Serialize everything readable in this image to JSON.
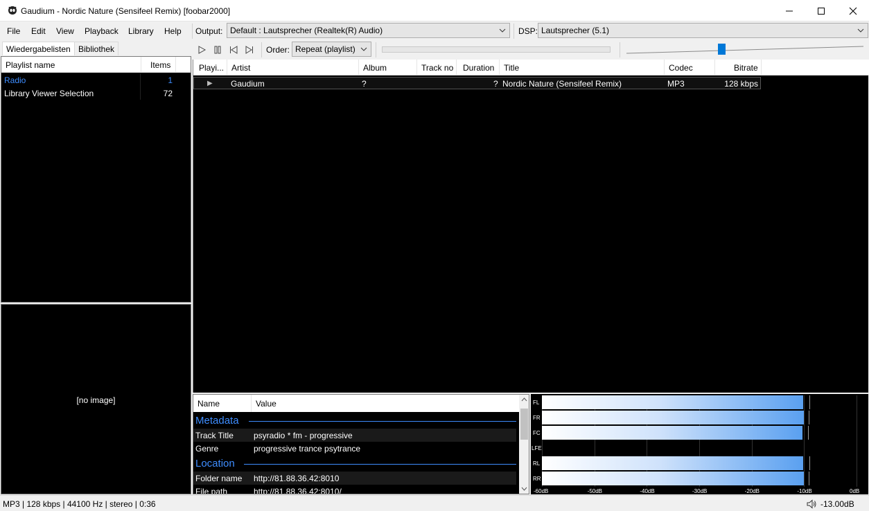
{
  "window": {
    "title": "Gaudium - Nordic Nature (Sensifeel Remix)  [foobar2000]"
  },
  "menu": [
    "File",
    "Edit",
    "View",
    "Playback",
    "Library",
    "Help"
  ],
  "toolbar": {
    "output_label": "Output:",
    "output_value": "Default : Lautsprecher (Realtek(R) Audio)",
    "dsp_label": "DSP:",
    "dsp_value": "Lautsprecher (5.1)",
    "order_label": "Order:",
    "order_value": "Repeat (playlist)",
    "volume_level": 0.4
  },
  "left_panel": {
    "tabs": [
      "Wiedergabelisten",
      "Bibliothek"
    ],
    "columns": [
      "Playlist name",
      "Items"
    ],
    "playlists": [
      {
        "name": "Radio",
        "items": "1"
      },
      {
        "name": "Library Viewer Selection",
        "items": "72"
      }
    ],
    "album_art_text": "[no image]"
  },
  "playlist": {
    "columns": [
      "Playi...",
      "Artist",
      "Album",
      "Track no",
      "Duration",
      "Title",
      "Codec",
      "Bitrate"
    ],
    "rows": [
      {
        "playing": "▶",
        "artist": "Gaudium",
        "album": "?",
        "track_no": "",
        "duration": "?",
        "title": "Nordic Nature (Sensifeel Remix)",
        "codec": "MP3",
        "bitrate": "128 kbps"
      }
    ]
  },
  "properties": {
    "columns": [
      "Name",
      "Value"
    ],
    "groups": [
      {
        "title": "Metadata",
        "rows": [
          {
            "name": "Track Title",
            "value": "psyradio * fm - progressive"
          },
          {
            "name": "Genre",
            "value": "progressive trance psytrance"
          }
        ]
      },
      {
        "title": "Location",
        "rows": [
          {
            "name": "Folder name",
            "value": "http://81.88.36.42:8010"
          },
          {
            "name": "File path",
            "value": "http://81.88.36.42:8010/"
          }
        ]
      }
    ]
  },
  "meter": {
    "channels": [
      {
        "name": "FL",
        "level_db": -10.2,
        "peak_db": -9.8
      },
      {
        "name": "FR",
        "level_db": -10.0,
        "peak_db": -9.9
      },
      {
        "name": "FC",
        "level_db": -10.3,
        "peak_db": -10.0
      },
      {
        "name": "LFE",
        "level_db": -60,
        "peak_db": -60
      },
      {
        "name": "RL",
        "level_db": -10.2,
        "peak_db": -9.8
      },
      {
        "name": "RR",
        "level_db": -10.0,
        "peak_db": -9.9
      }
    ],
    "scale": [
      "-60dB",
      "-50dB",
      "-40dB",
      "-30dB",
      "-20dB",
      "-10dB",
      "0dB"
    ]
  },
  "status": {
    "left": "MP3 | 128 kbps | 44100 Hz | stereo | 0:36",
    "volume": "-13.00dB"
  }
}
